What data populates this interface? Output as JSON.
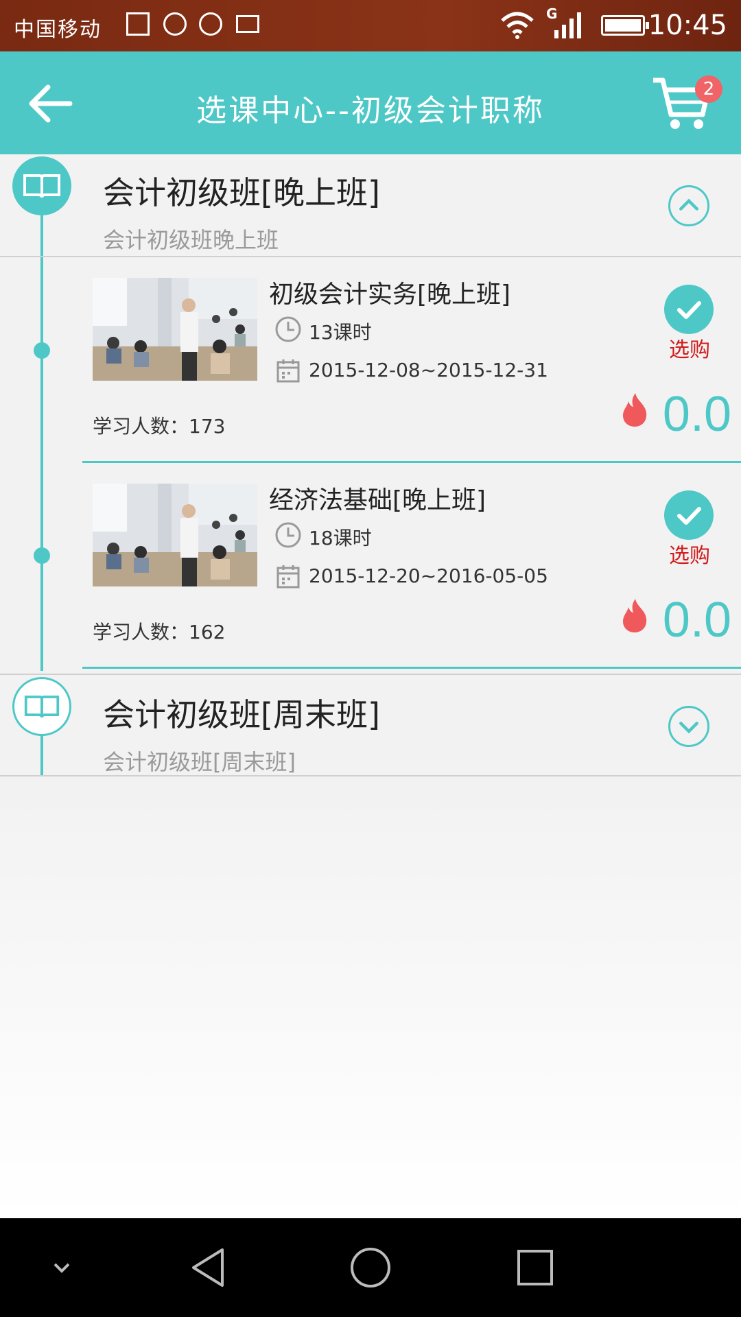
{
  "status_bar": {
    "carrier": "中国移动",
    "network": "G",
    "time": "10:45"
  },
  "header": {
    "title": "选课中心--初级会计职称",
    "cart_count": "2"
  },
  "groups": [
    {
      "title": "会计初级班[晚上班]",
      "subtitle": "会计初级班晚上班",
      "expanded": true,
      "courses": [
        {
          "title": "初级会计实务[晚上班]",
          "hours": "13课时",
          "dates": "2015-12-08~2015-12-31",
          "buy_label": "选购",
          "learners_label": "学习人数：",
          "learners": "173",
          "price": "0.0"
        },
        {
          "title": "经济法基础[晚上班]",
          "hours": "18课时",
          "dates": "2015-12-20~2016-05-05",
          "buy_label": "选购",
          "learners_label": "学习人数：",
          "learners": "162",
          "price": "0.0"
        }
      ]
    },
    {
      "title": "会计初级班[周末班]",
      "subtitle": "会计初级班[周末班]",
      "expanded": false
    }
  ],
  "colors": {
    "accent": "#4ec8c7",
    "buy": "#d11a1a",
    "badge": "#f06366",
    "status_bar": "#7a2a12"
  },
  "icons": [
    "back-arrow-icon",
    "cart-icon",
    "book-icon",
    "clock-icon",
    "calendar-icon",
    "check-icon",
    "fire-icon",
    "chevron-up-icon",
    "chevron-down-icon"
  ]
}
